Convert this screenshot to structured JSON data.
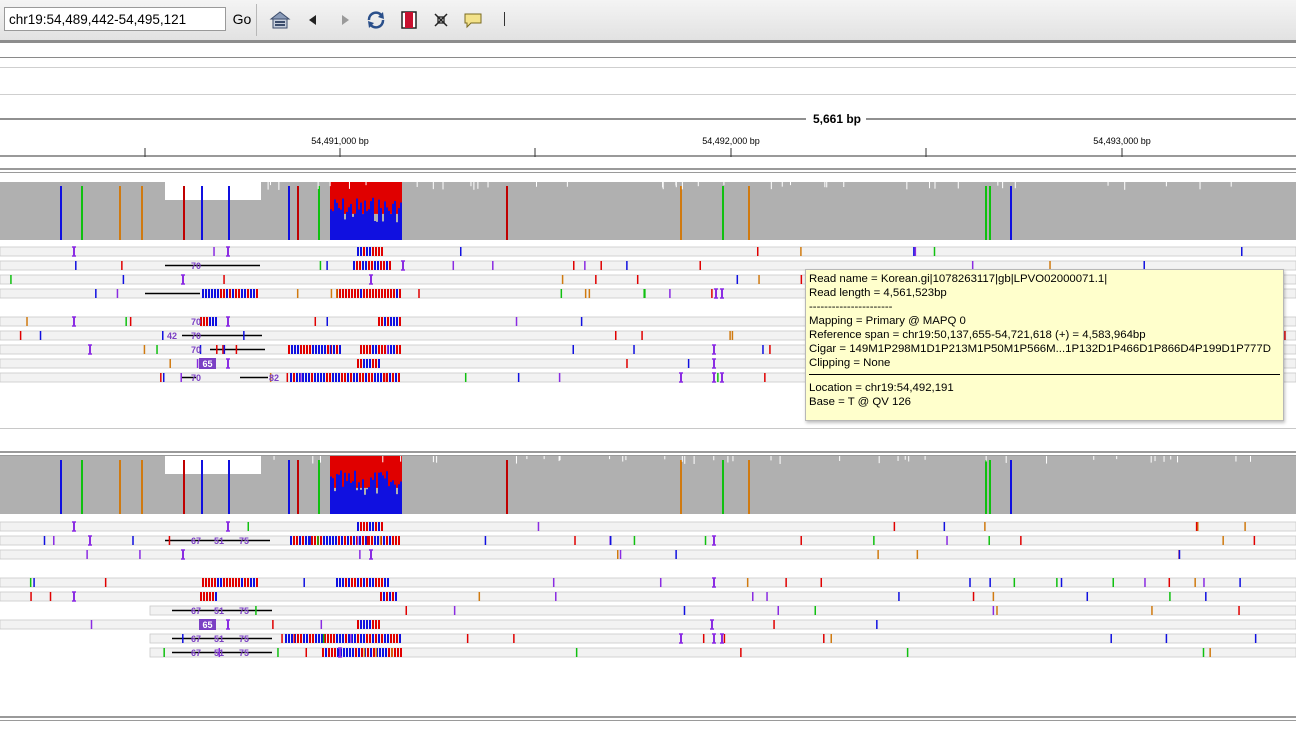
{
  "toolbar": {
    "locus_value": "chr19:54,489,442-54,495,121",
    "go_label": "Go",
    "icons": [
      "home-icon",
      "back-icon",
      "forward-icon",
      "refresh-icon",
      "roi-icon",
      "resize-icon",
      "popup-info-icon"
    ]
  },
  "ruler": {
    "span_label": "5,661 bp",
    "ticks": [
      "54,491,000 bp",
      "54,492,000 bp",
      "54,493,000 bp"
    ]
  },
  "insertion_labels": {
    "track1": [
      "70",
      "70",
      "42",
      "70",
      "70",
      "65",
      "70",
      "82"
    ],
    "track2": [
      "67",
      "51",
      "75",
      "67",
      "51",
      "75",
      "65",
      "67",
      "51",
      "75",
      "67",
      "51",
      "75"
    ]
  },
  "tooltip": {
    "read_name": "Read name = Korean.gi|1078263117|gb|LPVO02000071.1|",
    "read_length": "Read length = 4,561,523bp",
    "dashes": "----------------------",
    "mapping": "Mapping = Primary @ MAPQ 0",
    "reference_span": "Reference span = chr19:50,137,655-54,721,618 (+) = 4,583,964bp",
    "cigar": "Cigar = 149M1P298M1D1P213M1P50M1P566M...1P132D1P466D1P866D4P199D1P777D",
    "clipping": "Clipping = None",
    "location": "Location = chr19:54,492,191",
    "base": "Base = T @ QV 126"
  },
  "colors": {
    "coverage_gray": "#b0b0b0",
    "mismatch_red": "#e00000",
    "mismatch_blue": "#1010e0",
    "insertion_purple": "#8a2be2",
    "tooltip_bg": "#ffffcc"
  }
}
